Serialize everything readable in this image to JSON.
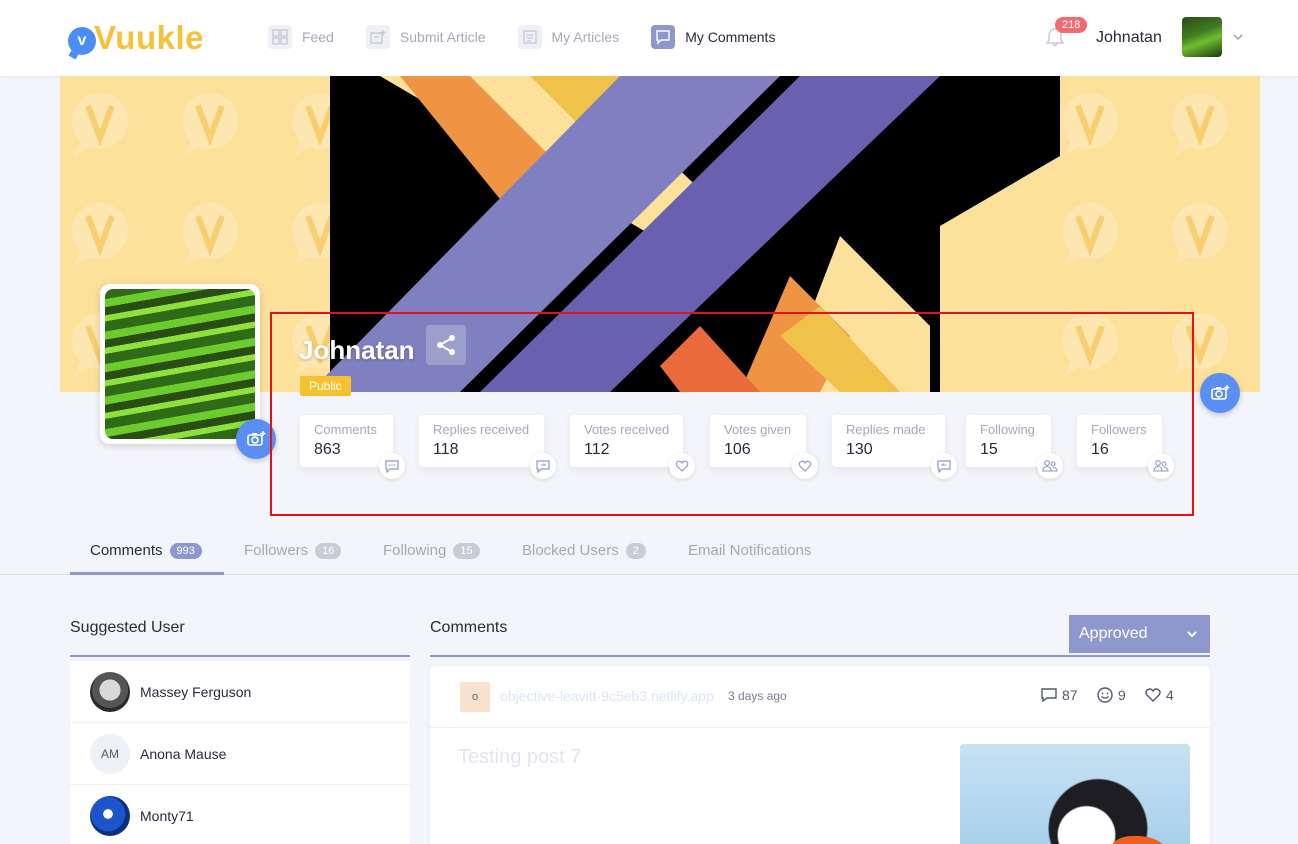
{
  "brand": {
    "logo_letter": "v",
    "name": "Vuukle"
  },
  "nav": [
    {
      "label": "Feed",
      "icon": "grid-icon",
      "active": false
    },
    {
      "label": "Submit Article",
      "icon": "submit-article-icon",
      "active": false
    },
    {
      "label": "My Articles",
      "icon": "articles-icon",
      "active": false
    },
    {
      "label": "My Comments",
      "icon": "comment-icon",
      "active": true
    }
  ],
  "header": {
    "notifications": "218",
    "username": "Johnatan"
  },
  "profile": {
    "name": "Johnatan",
    "visibility": "Public",
    "stats": [
      {
        "label": "Comments",
        "value": "863",
        "icon": "comment-dots-icon"
      },
      {
        "label": "Replies received",
        "value": "118",
        "icon": "reply-received-icon"
      },
      {
        "label": "Votes received",
        "value": "112",
        "icon": "heart-in-icon"
      },
      {
        "label": "Votes given",
        "value": "106",
        "icon": "heart-out-icon"
      },
      {
        "label": "Replies made",
        "value": "130",
        "icon": "reply-made-icon"
      },
      {
        "label": "Following",
        "value": "15",
        "icon": "users-following-icon"
      },
      {
        "label": "Followers",
        "value": "16",
        "icon": "users-followers-icon"
      }
    ]
  },
  "tabs": [
    {
      "label": "Comments",
      "count": "993",
      "active": true
    },
    {
      "label": "Followers",
      "count": "16",
      "active": false
    },
    {
      "label": "Following",
      "count": "15",
      "active": false
    },
    {
      "label": "Blocked Users",
      "count": "2",
      "active": false
    },
    {
      "label": "Email Notifications",
      "count": "",
      "active": false
    }
  ],
  "suggested": {
    "title": "Suggested User",
    "users": [
      {
        "name": "Massey Ferguson",
        "initials": ""
      },
      {
        "name": "Anona Mause",
        "initials": "AM"
      },
      {
        "name": "Monty71",
        "initials": ""
      }
    ]
  },
  "comments": {
    "title": "Comments",
    "filter": "Approved",
    "items": [
      {
        "site_icon": "o",
        "site": "objective-leavitt-9c5eb3.netlify.app",
        "time": "3 days ago",
        "comments_count": "87",
        "reactions_count": "9",
        "likes_count": "4",
        "title": "Testing post 7"
      }
    ]
  },
  "colors": {
    "accent": "#8f98cc",
    "brand_yellow": "#f5c23a",
    "camera_blue": "#5b8ef2",
    "badge_red": "#f06c72",
    "highlight_red": "#e0121b"
  }
}
